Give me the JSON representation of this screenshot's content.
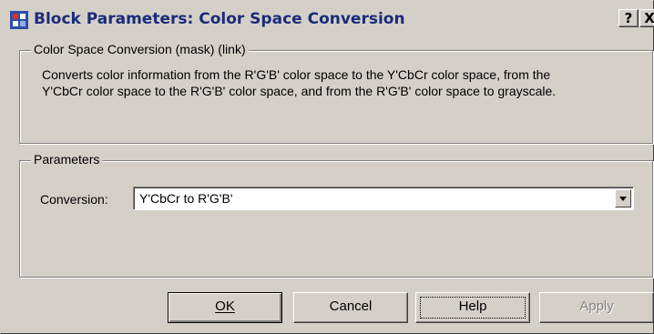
{
  "window": {
    "title": "Block Parameters: Color Space  Conversion",
    "help_button": "?",
    "close_button": "X"
  },
  "mask_group": {
    "legend": "Color Space Conversion (mask) (link)",
    "description": "Converts color information from the R'G'B' color space to the Y'CbCr color space, from the Y'CbCr color space to the R'G'B' color space, and from the R'G'B' color space to grayscale."
  },
  "parameters_group": {
    "legend": "Parameters",
    "conversion_label": "Conversion:",
    "conversion_value": "Y'CbCr to R'G'B'"
  },
  "buttons": {
    "ok": "OK",
    "cancel": "Cancel",
    "help": "Help",
    "apply": "Apply"
  },
  "colors": {
    "face": "#d4d0c8",
    "title_text": "#1b2b7a",
    "disabled_text": "#808080"
  }
}
